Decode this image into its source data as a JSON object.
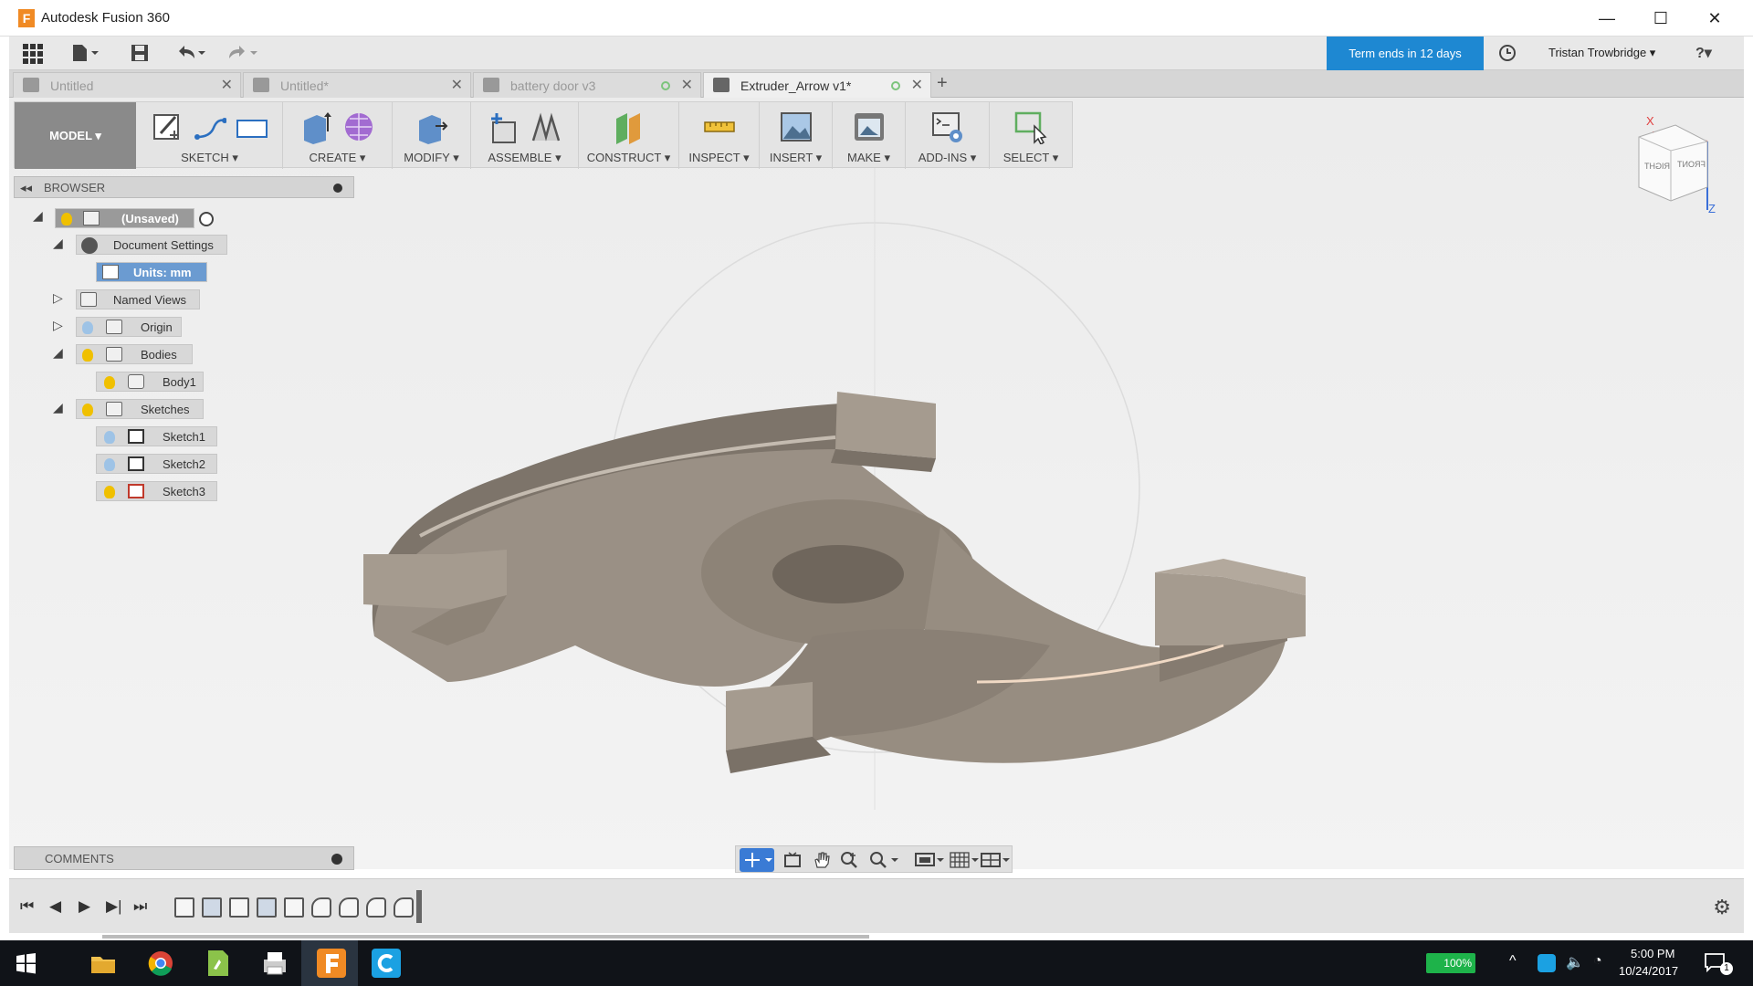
{
  "window": {
    "title": "Autodesk Fusion 360",
    "logo_letter": "F",
    "minimize": "—",
    "maximize": "☐",
    "close": "✕"
  },
  "app_toolbar": {
    "term_notice": "Term ends in 12 days",
    "user_name": "Tristan Trowbridge ▾",
    "help": "?▾"
  },
  "tabs": [
    {
      "label": "Untitled",
      "active": false
    },
    {
      "label": "Untitled*",
      "active": false
    },
    {
      "label": "battery door v3",
      "active": false
    },
    {
      "label": "Extruder_Arrow v1*",
      "active": true
    }
  ],
  "ribbon": {
    "workspace": "MODEL ▾",
    "groups": [
      {
        "label": "SKETCH ▾"
      },
      {
        "label": "CREATE ▾"
      },
      {
        "label": "MODIFY ▾"
      },
      {
        "label": "ASSEMBLE ▾"
      },
      {
        "label": "CONSTRUCT ▾"
      },
      {
        "label": "INSPECT ▾"
      },
      {
        "label": "INSERT ▾"
      },
      {
        "label": "MAKE ▾"
      },
      {
        "label": "ADD-INS ▾"
      },
      {
        "label": "SELECT ▾"
      }
    ]
  },
  "browser": {
    "header": "BROWSER",
    "collapse_icon": "◂◂",
    "root": "(Unsaved)",
    "document_settings": "Document Settings",
    "units": "Units: mm",
    "named_views": "Named Views",
    "origin": "Origin",
    "bodies": "Bodies",
    "body1": "Body1",
    "sketches": "Sketches",
    "sketch1": "Sketch1",
    "sketch2": "Sketch2",
    "sketch3": "Sketch3"
  },
  "comments": {
    "label": "COMMENTS"
  },
  "viewcube": {
    "x_label": "X",
    "z_label": "Z",
    "face_front": "FRONT",
    "face_right": "RIGHT"
  },
  "taskbar": {
    "battery": "100%",
    "time": "5:00 PM",
    "date": "10/24/2017",
    "notifications": "1"
  },
  "colors": {
    "accent_blue": "#1e88d2",
    "selection_blue": "#6b9bd1",
    "model_metal": "#8f857a"
  }
}
